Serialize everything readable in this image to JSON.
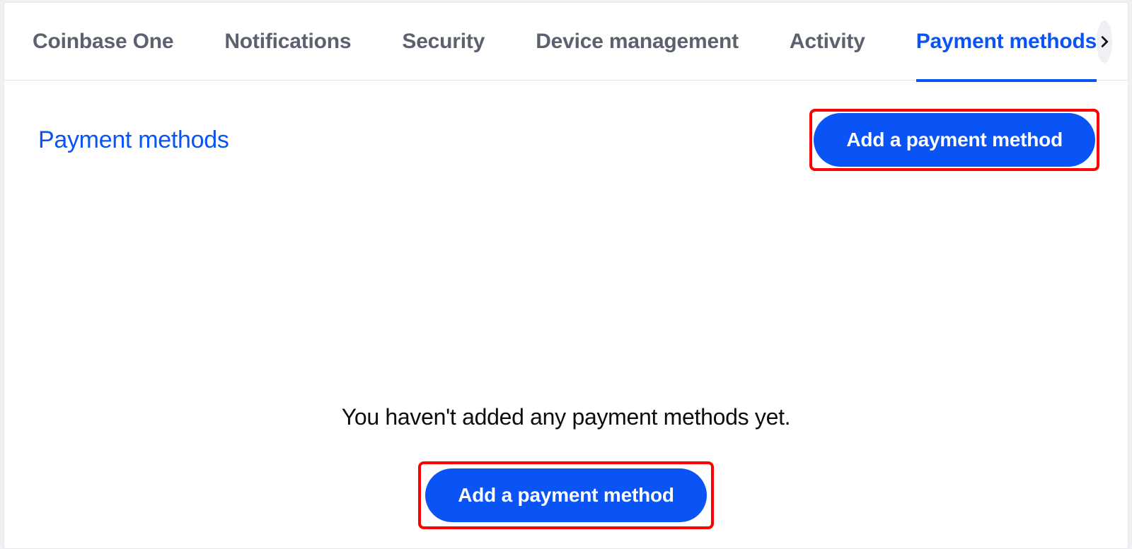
{
  "tabs": {
    "items": [
      {
        "label": "Coinbase One",
        "active": false
      },
      {
        "label": "Notifications",
        "active": false
      },
      {
        "label": "Security",
        "active": false
      },
      {
        "label": "Device management",
        "active": false
      },
      {
        "label": "Activity",
        "active": false
      },
      {
        "label": "Payment methods",
        "active": true
      }
    ]
  },
  "section": {
    "title": "Payment methods",
    "add_button_label": "Add a payment method"
  },
  "empty_state": {
    "message": "You haven't added any payment methods yet.",
    "add_button_label": "Add a payment method"
  },
  "colors": {
    "accent": "#0a53f5",
    "highlight_border": "#ff0000",
    "text_muted": "#5b616e",
    "text": "#0b0d10"
  }
}
